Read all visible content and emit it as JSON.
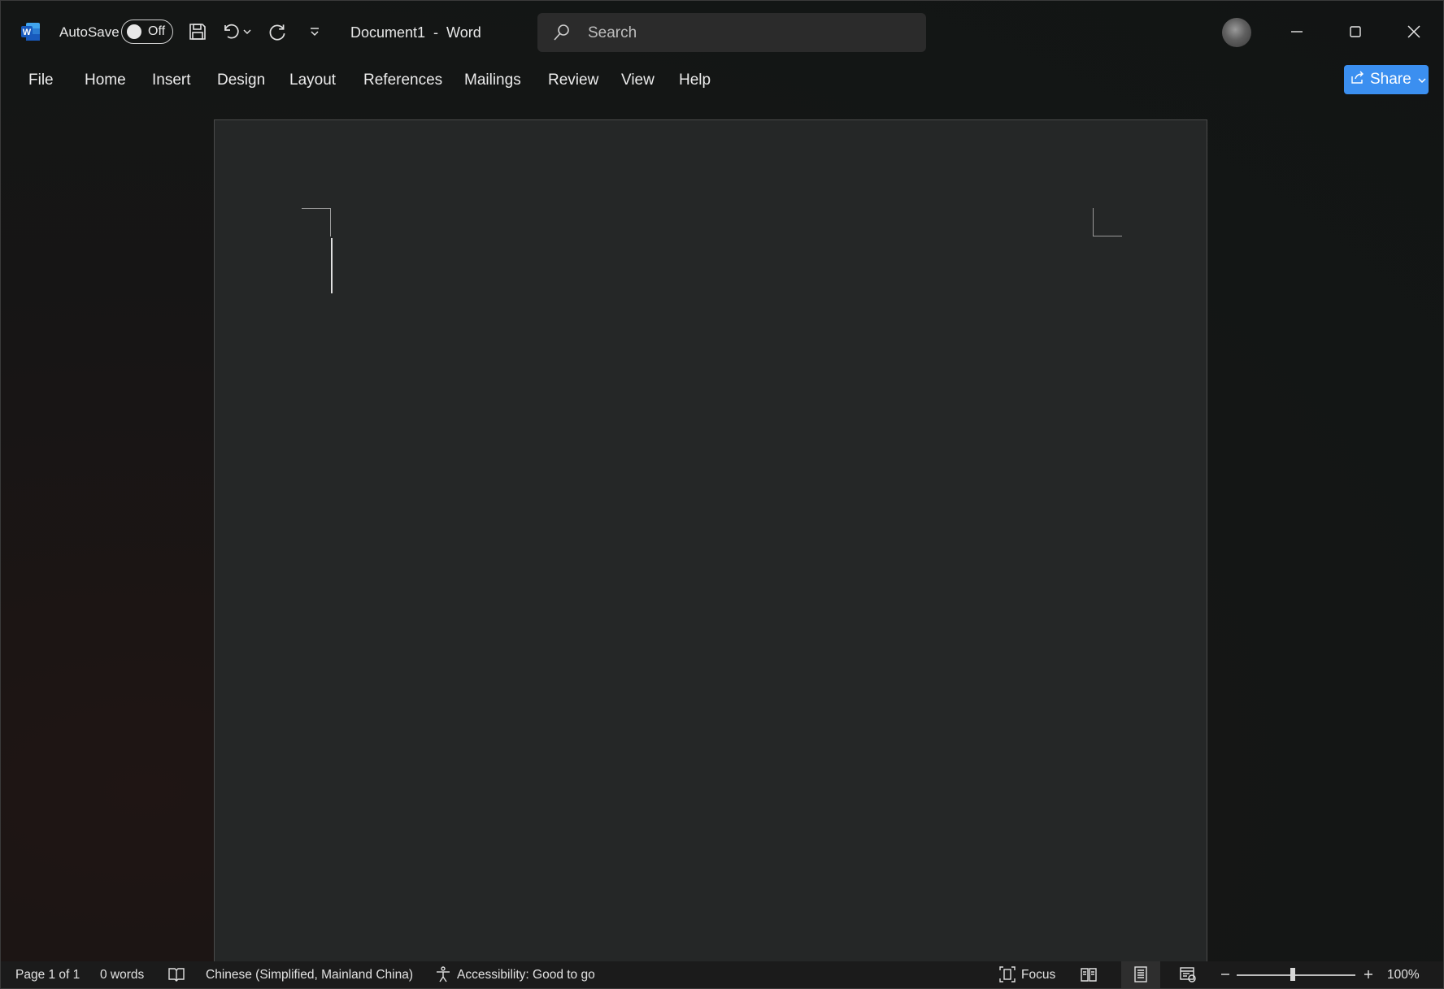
{
  "titlebar": {
    "autosave_label": "AutoSave",
    "autosave_state": "Off",
    "document_title": "Document1  -  Word",
    "search_placeholder": "Search",
    "app_icon": "word-icon",
    "icons": [
      "save-icon",
      "undo-icon",
      "chevron-down-icon",
      "redo-icon",
      "customize-toolbar-icon",
      "minimize-icon",
      "maximize-icon",
      "close-icon"
    ]
  },
  "menubar": {
    "items": [
      "File",
      "Home",
      "Insert",
      "Design",
      "Layout",
      "References",
      "Mailings",
      "Review",
      "View",
      "Help"
    ],
    "share_label": "Share"
  },
  "statusbar": {
    "page_info": "Page 1 of 1",
    "word_count": "0 words",
    "language": "Chinese (Simplified, Mainland China)",
    "accessibility": "Accessibility: Good to go",
    "focus_label": "Focus",
    "zoom_level": "100%",
    "zoom_fraction": 0.47
  },
  "colors": {
    "accent": "#3b8ff0",
    "page": "#252727",
    "word_brand": "#2b579a"
  }
}
